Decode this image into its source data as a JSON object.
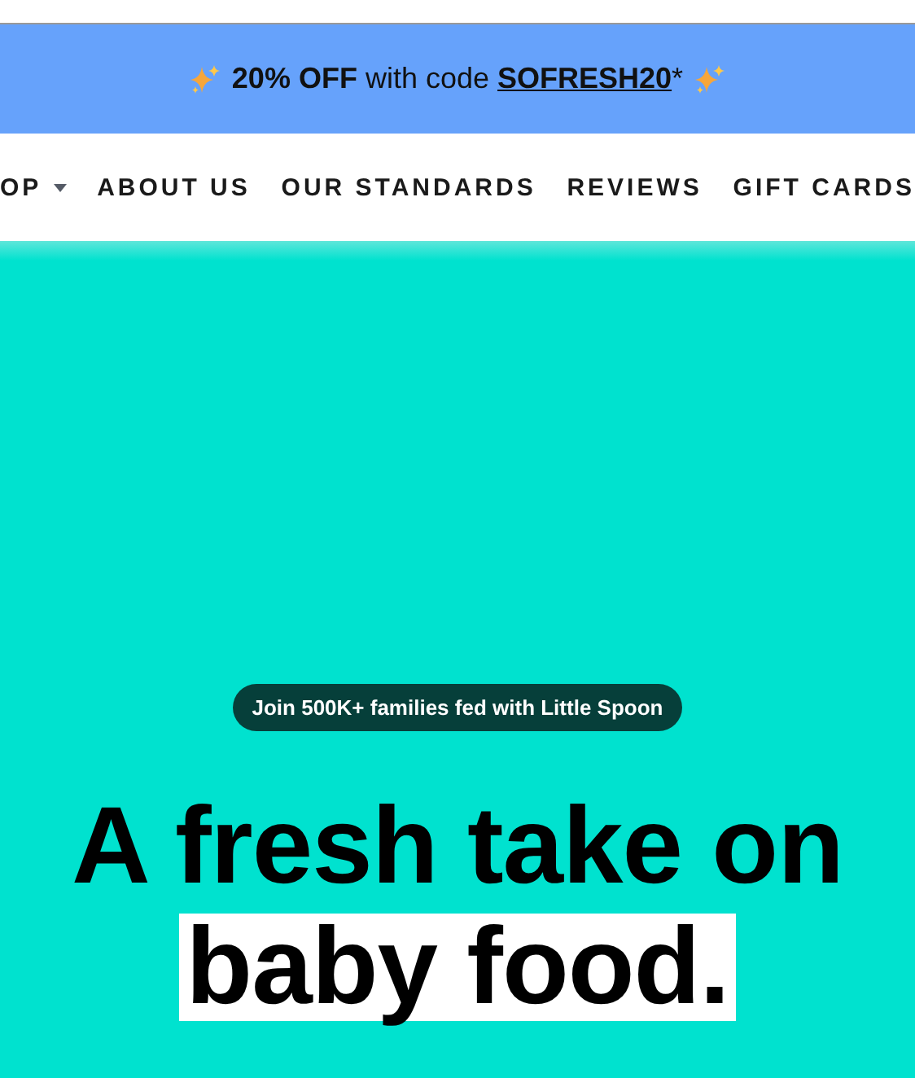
{
  "promo_banner": {
    "text": "**20% OFF** with code ",
    "code": "SOFRESH20",
    "suffix": "*"
  },
  "nav": {
    "items": [
      {
        "label": "OP",
        "has_dropdown": true
      },
      {
        "label": "ABOUT US",
        "has_dropdown": false
      },
      {
        "label": "OUR STANDARDS",
        "has_dropdown": false
      },
      {
        "label": "REVIEWS",
        "has_dropdown": false
      },
      {
        "label": "GIFT CARDS",
        "has_dropdown": false
      }
    ]
  },
  "hero": {
    "badge": "Join **500K+** families fed with Little Spoon",
    "headline": [
      {
        "text": "A fresh take on",
        "highlight": false
      },
      {
        "text": "baby food.",
        "highlight": true
      }
    ]
  }
}
